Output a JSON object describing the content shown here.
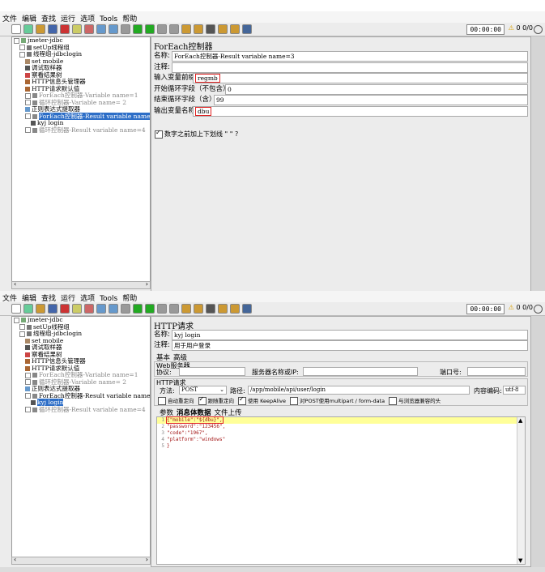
{
  "menu": [
    "文件",
    "编辑",
    "查找",
    "运行",
    "选项",
    "Tools",
    "帮助"
  ],
  "toolbar": {
    "timer": "00:00:00",
    "warn_count": "0",
    "ratio": "0/0"
  },
  "colors": {
    "selected": "#2d6ec7",
    "highlight_box": "#e02020",
    "editor_highlight": "#ffff99"
  },
  "top": {
    "tree": [
      {
        "label": "jmeter-jdbc",
        "level": 0,
        "icon": "testplan-icon",
        "exp": true
      },
      {
        "label": "setUp线程组",
        "level": 1,
        "icon": "gear-icon",
        "exp": true
      },
      {
        "label": "线程组-jdbclogin",
        "level": 1,
        "icon": "gear-icon",
        "exp": true
      },
      {
        "label": "set mobile",
        "level": 2,
        "icon": "wand-icon"
      },
      {
        "label": "调试取样器",
        "level": 2,
        "icon": "pencil-icon"
      },
      {
        "label": "察看结果树",
        "level": 2,
        "icon": "report-icon"
      },
      {
        "label": "HTTP信息头管理器",
        "level": 2,
        "icon": "tools-icon"
      },
      {
        "label": "HTTP请求默认值",
        "level": 2,
        "icon": "tools-icon"
      },
      {
        "label": "ForEach控制器-Variable name=1",
        "level": 2,
        "icon": "loop-icon",
        "exp": true,
        "dis": true
      },
      {
        "label": "循环控制器-Variable name= 2",
        "level": 2,
        "icon": "loop-icon",
        "exp": true,
        "dis": true
      },
      {
        "label": "正则表达式提取器",
        "level": 2,
        "icon": "extract-icon"
      },
      {
        "label": "ForEach控制器-Result variable name=",
        "level": 2,
        "icon": "loop-icon",
        "exp": true,
        "sel": true
      },
      {
        "label": "kyj login",
        "level": 3,
        "icon": "pencil-icon"
      },
      {
        "label": "循环控制器-Result variable name=4",
        "level": 2,
        "icon": "loop-icon",
        "exp": true,
        "dis": true
      }
    ],
    "panel_title": "ForEach控制器",
    "fields": [
      {
        "label": "名称:",
        "value": "ForEach控制器-Result variable name=3"
      },
      {
        "label": "注释:",
        "value": ""
      },
      {
        "label": "输入变量前缀",
        "value": "regmb",
        "boxed": true
      },
      {
        "label": "开始循环字段（不包含）",
        "value": "0"
      },
      {
        "label": "结束循环字段（含）",
        "value": "99"
      },
      {
        "label": "输出变量名称",
        "value": "dbu",
        "boxed": true
      }
    ],
    "checkbox_label": "数字之前加上下划线 \" \" ?"
  },
  "bottom": {
    "tree": [
      {
        "label": "jmeter-jdbc",
        "level": 0,
        "icon": "testplan-icon",
        "exp": true
      },
      {
        "label": "setUp线程组",
        "level": 1,
        "icon": "gear-icon",
        "exp": true
      },
      {
        "label": "线程组-jdbclogin",
        "level": 1,
        "icon": "gear-icon",
        "exp": true
      },
      {
        "label": "set mobile",
        "level": 2,
        "icon": "wand-icon"
      },
      {
        "label": "调试取样器",
        "level": 2,
        "icon": "pencil-icon"
      },
      {
        "label": "察看结果树",
        "level": 2,
        "icon": "report-icon"
      },
      {
        "label": "HTTP信息头管理器",
        "level": 2,
        "icon": "tools-icon"
      },
      {
        "label": "HTTP请求默认值",
        "level": 2,
        "icon": "tools-icon"
      },
      {
        "label": "ForEach控制器-Variable name=1",
        "level": 2,
        "icon": "loop-icon",
        "exp": true,
        "dis": true
      },
      {
        "label": "循环控制器-Variable name= 2",
        "level": 2,
        "icon": "loop-icon",
        "exp": true,
        "dis": true
      },
      {
        "label": "正则表达式提取器",
        "level": 2,
        "icon": "extract-icon"
      },
      {
        "label": "ForEach控制器-Result variable name=",
        "level": 2,
        "icon": "loop-icon",
        "exp": true
      },
      {
        "label": "kyj login",
        "level": 3,
        "icon": "pencil-icon",
        "sel": true
      },
      {
        "label": "循环控制器-Result variable name=4",
        "level": 2,
        "icon": "loop-icon",
        "exp": true,
        "dis": true
      }
    ],
    "panel_title": "HTTP请求",
    "name_label": "名称:",
    "name_value": "kyj login",
    "comment_label": "注释:",
    "comment_value": "用于用户登录",
    "tabs": [
      "基本",
      "高级"
    ],
    "web_server": "Web服务器",
    "protocol_label": "协议:",
    "server_label": "服务器名称或IP:",
    "port_label": "端口号:",
    "http_request": "HTTP请求",
    "method_label": "方法:",
    "method_value": "POST",
    "path_label": "路径:",
    "path_value": "/app/mobile/api/user/login",
    "encoding_label": "内容编码:",
    "encoding_value": "utf-8",
    "options": [
      {
        "label": "自动重定向",
        "on": false
      },
      {
        "label": "跟随重定向",
        "on": true
      },
      {
        "label": "使用 KeepAlive",
        "on": true
      },
      {
        "label": "对POST使用multipart / form-data",
        "on": false
      },
      {
        "label": "与浏览器兼容的头",
        "on": false
      }
    ],
    "body_tabs": [
      "参数",
      "消息体数据",
      "文件上传"
    ],
    "body_lines": [
      {
        "n": "1",
        "text": "{\"mobile\":\"${dbu}\","
      },
      {
        "n": "2",
        "text": "\"password\":\"123456\","
      },
      {
        "n": "3",
        "text": "\"code\":\"1967\","
      },
      {
        "n": "4",
        "text": "\"platform\":\"windows\""
      },
      {
        "n": "5",
        "text": "}"
      }
    ]
  }
}
